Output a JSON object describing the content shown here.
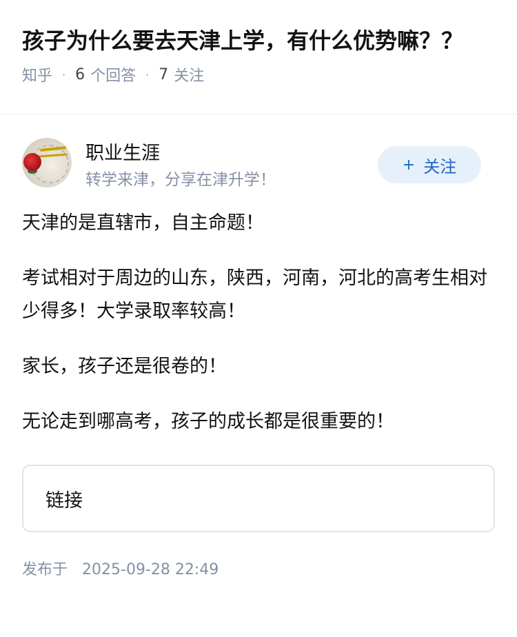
{
  "question": {
    "title": "孩子为什么要去天津上学，有什么优势嘛？？",
    "source": "知乎",
    "answer_count": "6",
    "answer_label": "个回答",
    "follower_count": "7",
    "follower_label": "关注",
    "separator": "·"
  },
  "author": {
    "name": "职业生涯",
    "bio": "转学来津，分享在津升学！",
    "follow_plus": "+",
    "follow_label": "关注"
  },
  "answer": {
    "paragraphs": [
      "天津的是直辖市，自主命题！",
      "考试相对于周边的山东，陕西，河南，河北的高考生相对少得多！大学录取率较高！",
      "家长，孩子还是很卷的！",
      "无论走到哪高考，孩子的成长都是很重要的！"
    ],
    "link_card_label": "链接",
    "published_label": "发布于",
    "published_time": "2025-09-28 22:49"
  },
  "colors": {
    "accent": "#1e64c8",
    "follow_bg": "#e6f0fb",
    "meta_text": "#8590a6"
  }
}
